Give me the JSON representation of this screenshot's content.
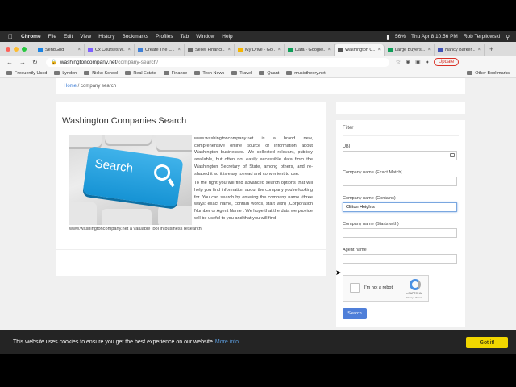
{
  "menubar": {
    "app": "Chrome",
    "items": [
      "File",
      "Edit",
      "View",
      "History",
      "Bookmarks",
      "Profiles",
      "Tab",
      "Window",
      "Help"
    ],
    "battery": "56%",
    "datetime": "Thu Apr 8  10:56 PM",
    "user": "Rob Terpilowski"
  },
  "tabs": [
    {
      "title": "SendGrid",
      "color": "#1a82e2"
    },
    {
      "title": "Cx Courses W...",
      "color": "#7d5fff"
    },
    {
      "title": "Create The L...",
      "color": "#3f7fd6"
    },
    {
      "title": "Seller Financi...",
      "color": "#6a6a6a"
    },
    {
      "title": "My Drive - Go...",
      "color": "#f4b400"
    },
    {
      "title": "Data - Google...",
      "color": "#0f9d58"
    },
    {
      "title": "Washington C...",
      "color": "#555555"
    },
    {
      "title": "Large Buyers...",
      "color": "#0f9d58"
    },
    {
      "title": "Nancy Barker...",
      "color": "#3f51b5"
    }
  ],
  "address": {
    "host": "washingtoncompany.net",
    "path": "/company-search/",
    "update_label": "Update"
  },
  "bookmarks": {
    "items": [
      "Frequently Used",
      "Lynden",
      "Nicko School",
      "Real Estate",
      "Finance",
      "Tech News",
      "Travel",
      "Quant",
      "musictheory.net"
    ],
    "other": "Other Bookmarks"
  },
  "breadcrumb": {
    "home": "Home",
    "current": " / company search"
  },
  "main": {
    "title": "Washington Companies Search",
    "image_text": "Search",
    "para1": "www.washingtoncompany.net is a brand new, comprehensive online source of information about Washington businesses. We collected relevant, publicly available, but often not easily accessible data from the Washington Secretary of State, among others, and re-shaped it so it is easy to read and convenient to use.",
    "para2": "To the right you will find advanced search options that will help you find information about the company you're looking for. You can search by entering the company name (three ways: exact name, contain words, start with) ,Corporation Number or Agent Name . We hope that the data we provide will be useful to you and that you will find",
    "tail": "www.washingtoncompany.net a valuable tool in business research."
  },
  "filter": {
    "heading": "Filter",
    "ubi_label": "UBI",
    "ubi_value": "",
    "exact_label": "Company name (Exact Match)",
    "exact_value": "",
    "contains_label": "Company name (Contains)",
    "contains_value": "Clifton Heights",
    "starts_label": "Company name (Starts with)",
    "starts_value": "",
    "agent_label": "Agent name",
    "agent_value": "",
    "captcha_label": "I'm not a robot",
    "captcha_brand": "reCAPTCHA",
    "captcha_terms": "Privacy - Terms",
    "search_label": "Search"
  },
  "cookie": {
    "text": "This website uses cookies to ensure you get the best experience on our website",
    "link": "More info",
    "button": "Got it!"
  }
}
